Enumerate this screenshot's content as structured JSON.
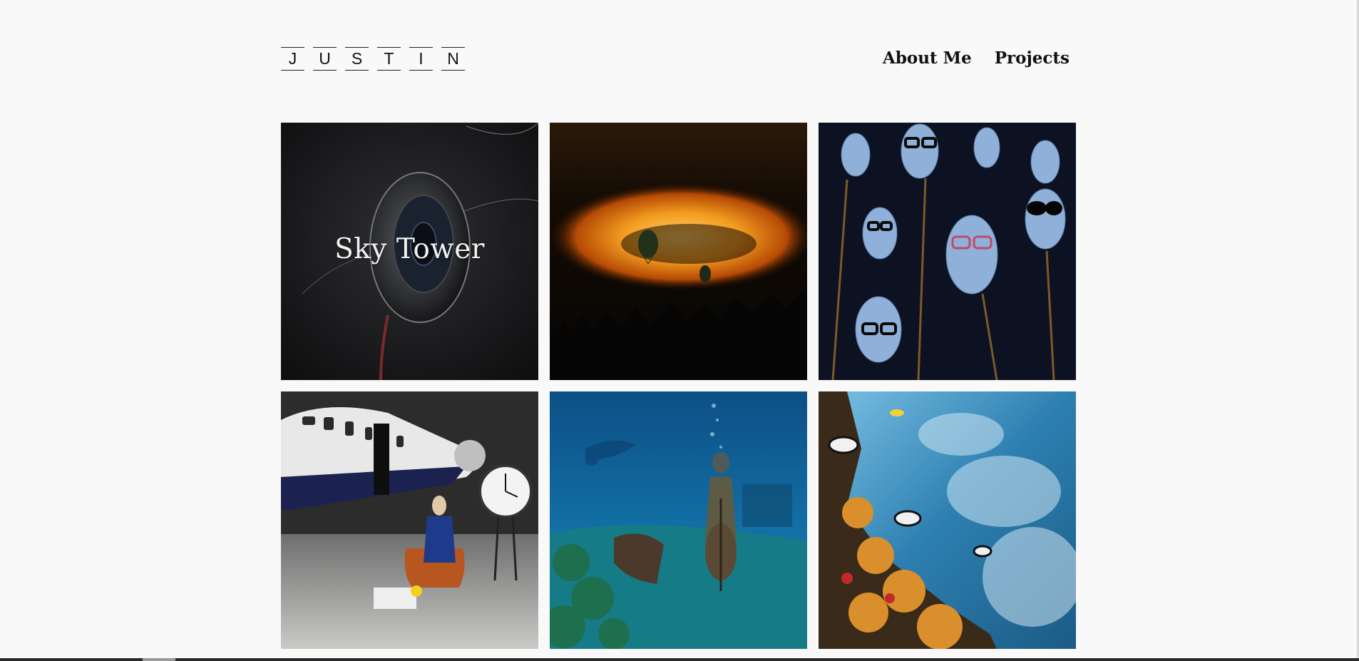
{
  "header": {
    "logo_letters": [
      "J",
      "U",
      "S",
      "T",
      "I",
      "N"
    ],
    "nav": [
      {
        "label": "About Me"
      },
      {
        "label": "Projects"
      }
    ]
  },
  "gallery": {
    "tiles": [
      {
        "caption": "Sky Tower",
        "subject": "speaker device"
      },
      {
        "caption": "",
        "subject": "balloons over fire clouds"
      },
      {
        "caption": "",
        "subject": "mannequin heads with glasses"
      },
      {
        "caption": "",
        "subject": "woman by private jet and clock"
      },
      {
        "caption": "",
        "subject": "underwater cello player"
      },
      {
        "caption": "",
        "subject": "coral reef with fish"
      }
    ]
  },
  "colors": {
    "background": "#f9f9f9",
    "text": "#111111"
  }
}
